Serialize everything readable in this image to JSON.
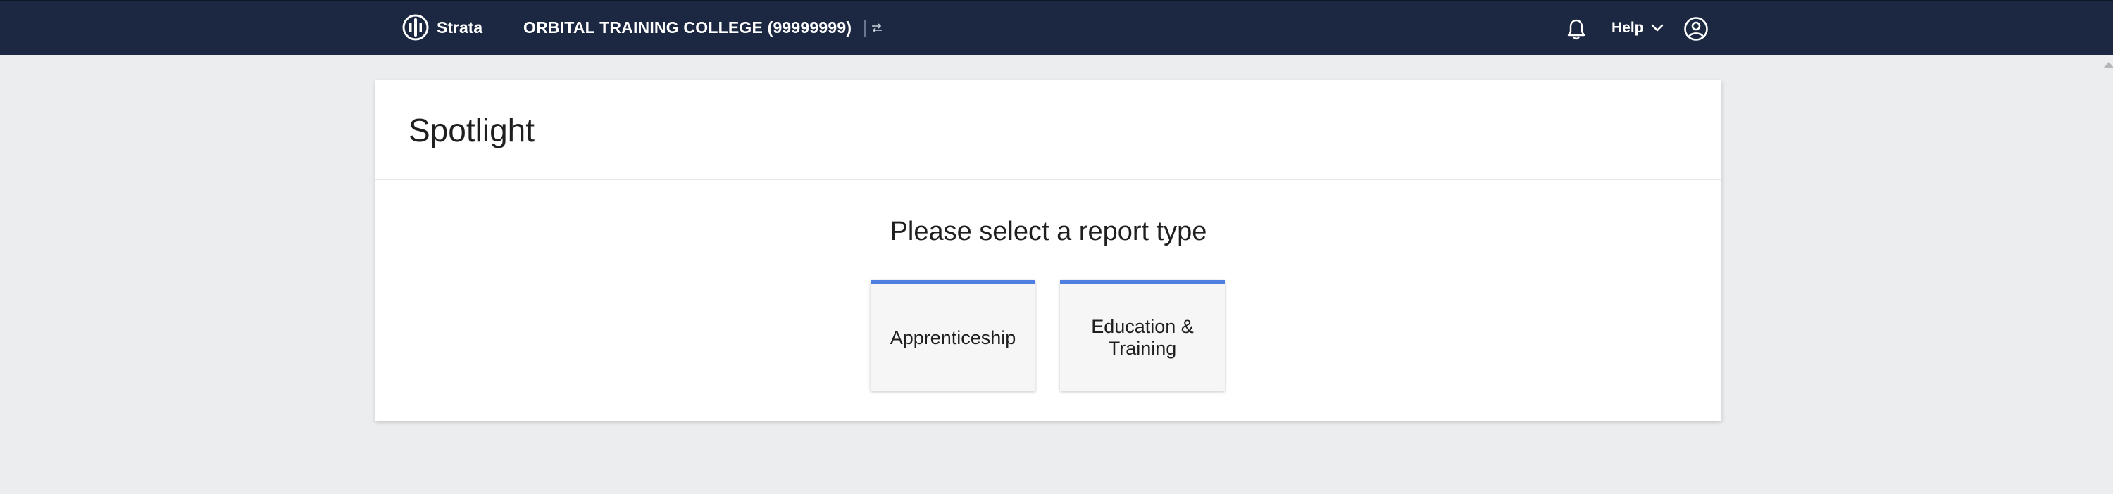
{
  "header": {
    "brand_name": "Strata",
    "org_name": "ORBITAL TRAINING COLLEGE (99999999)",
    "help_label": "Help",
    "icons": {
      "logo": "strata-logo-icon",
      "switch": "switch-org-icon",
      "bell": "bell-icon",
      "help_chevron": "chevron-down-icon",
      "account": "user-circle-icon"
    }
  },
  "main": {
    "title": "Spotlight",
    "prompt": "Please select a report type",
    "report_types": [
      {
        "label": "Apprenticeship"
      },
      {
        "label": "Education & Training"
      }
    ]
  },
  "colors": {
    "topbar": "#1c2841",
    "page_background": "#ebedef",
    "tile_accent": "#4f80e1",
    "tile_background": "#f6f6f6"
  }
}
